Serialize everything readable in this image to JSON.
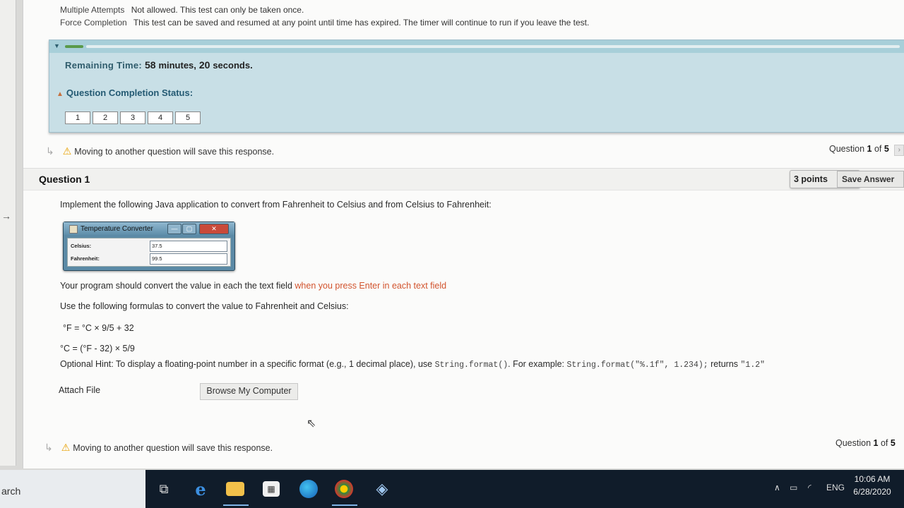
{
  "test_info": {
    "multiple_attempts_label": "Multiple Attempts",
    "multiple_attempts_value": "Not allowed. This test can only be taken once.",
    "force_completion_label": "Force Completion",
    "force_completion_value": "This test can be saved and resumed at any point until time has expired. The timer will continue to run if you leave the test."
  },
  "timer": {
    "label": "Remaining Time:",
    "value_minutes": "58",
    "minutes_word": "minutes,",
    "value_seconds": "20",
    "seconds_word": "seconds."
  },
  "completion": {
    "label": "Question Completion Status:",
    "questions": [
      "1",
      "2",
      "3",
      "4",
      "5"
    ]
  },
  "nav_top": {
    "warning": "Moving to another question will save this response.",
    "question_prefix": "Question",
    "question_current": "1",
    "question_of": "of",
    "question_total": "5"
  },
  "question": {
    "title": "Question 1",
    "points": "3 points",
    "save_label": "Save Answer",
    "prompt": "Implement the following Java application to convert from Fahrenheit to Celsius and from Celsius to Fahrenheit:",
    "java_window": {
      "title": "Temperature Converter",
      "celsius_label": "Celsius:",
      "celsius_value": "37.5",
      "fahrenheit_label": "Fahrenheit:",
      "fahrenheit_value": "99.5"
    },
    "line1_a": "Your program should convert the value in each the text field",
    "line1_b": "when you press Enter in each text field",
    "line2": "Use the following formulas to convert the value to Fahrenheit and Celsius:",
    "formula1": "°F = °C  ×  9/5 + 32",
    "formula2": "°C = (°F  -  32)  ×  5/9",
    "hint_a": "Optional Hint: To display a floating-point number in a specific format (e.g., 1 decimal place), use",
    "hint_code1": "String.format()",
    "hint_b": ". For example:",
    "hint_code2": "String.format(\"%.1f\", 1.234);",
    "hint_c": "returns",
    "hint_code3": "\"1.2\"",
    "attach_label": "Attach File",
    "browse_label": "Browse My Computer"
  },
  "nav_bottom": {
    "warning": "Moving to another question will save this response.",
    "question_prefix": "Question",
    "question_current": "1",
    "question_of": "of",
    "question_total": "5"
  },
  "taskbar": {
    "search_text": "arch",
    "language": "ENG",
    "time": "10:06 AM",
    "date": "6/28/2020"
  }
}
